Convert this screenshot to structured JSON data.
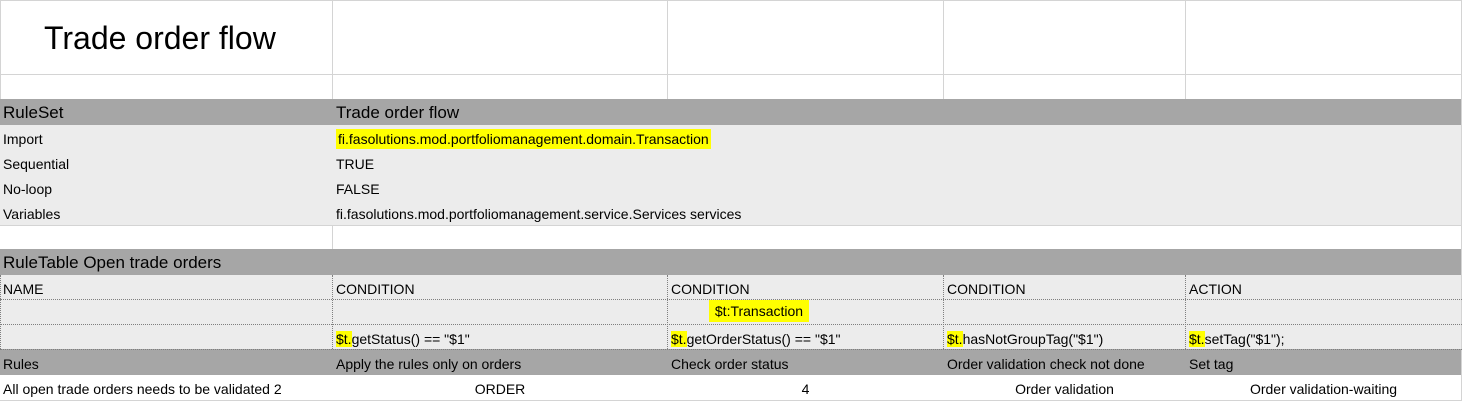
{
  "sheet_title": "Trade order flow",
  "ruleset": {
    "label": "RuleSet",
    "name": "Trade order flow",
    "rows": [
      {
        "key": "Import",
        "value": "fi.fasolutions.mod.portfoliomanagement.domain.Transaction"
      },
      {
        "key": "Sequential",
        "value": "TRUE"
      },
      {
        "key": "No-loop",
        "value": "FALSE"
      },
      {
        "key": "Variables",
        "value": "fi.fasolutions.mod.portfoliomanagement.service.Services services"
      }
    ]
  },
  "ruletable": {
    "title": "RuleTable Open trade orders",
    "header": [
      "NAME",
      "CONDITION",
      "CONDITION",
      "CONDITION",
      "ACTION"
    ],
    "object_binding": "$t:Transaction",
    "code_prefix": "$t.",
    "code": [
      "getStatus() == \"$1\"",
      "getOrderStatus() == \"$1\"",
      "hasNotGroupTag(\"$1\")",
      "setTag(\"$1\");"
    ],
    "descriptions": [
      "Rules",
      "Apply the rules only on orders",
      "Check order status",
      "Order validation check not done",
      "Set tag"
    ],
    "data_rows": [
      [
        "All open trade orders needs to be validated 2",
        "ORDER",
        "4",
        "Order validation",
        "Order validation-waiting"
      ]
    ]
  },
  "colors": {
    "grey_band": "#a6a6a6",
    "light_band": "#ececec",
    "highlight": "#ffff00",
    "grid": "#d4d4d4"
  }
}
